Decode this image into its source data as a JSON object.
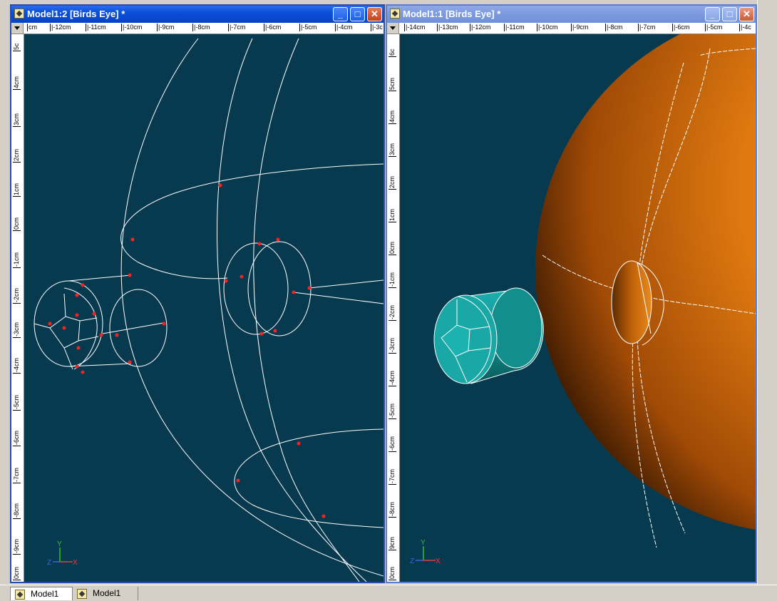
{
  "windows": [
    {
      "title": "Model1:2 [Birds Eye] *",
      "hruler": [
        "cm",
        "|-12cm",
        "|-11cm",
        "|-10cm",
        "|-9cm",
        "|-8cm",
        "|-7cm",
        "|-6cm",
        "|-5cm",
        "|-4cm",
        "|-3c"
      ],
      "vruler": [
        "5c",
        "4cm",
        "3cm",
        "2cm",
        "1cm",
        "0cm",
        "-1cm",
        "-2cm",
        "-3cm",
        "-4cm",
        "-5cm",
        "-6cm",
        "-7cm",
        "-8cm",
        "-9cm",
        "0cm"
      ]
    },
    {
      "title": "Model1:1 [Birds Eye] *",
      "hruler": [
        "|-14cm",
        "|-13cm",
        "|-12cm",
        "|-11cm",
        "|-10cm",
        "|-9cm",
        "|-8cm",
        "|-7cm",
        "|-6cm",
        "|-5cm",
        "|-4c"
      ],
      "vruler": [
        "6c",
        "5cm",
        "4cm",
        "3cm",
        "2cm",
        "1cm",
        "0cm",
        "-1cm",
        "-2cm",
        "-3cm",
        "-4cm",
        "-5cm",
        "-6cm",
        "-7cm",
        "-8cm",
        "9cm",
        "0cm"
      ]
    }
  ],
  "controls": {
    "minimize": "_",
    "maximize": "□",
    "close": "✕"
  },
  "axis": {
    "x": "X",
    "y": "Y",
    "z": "Z"
  },
  "colors": {
    "viewport_bg": "#073a4f",
    "sphere": "#e07a10",
    "cylinder": "#138c8c",
    "vertex": "#ff2020"
  },
  "taskbar": {
    "items": [
      "Model1",
      "Model1"
    ]
  }
}
